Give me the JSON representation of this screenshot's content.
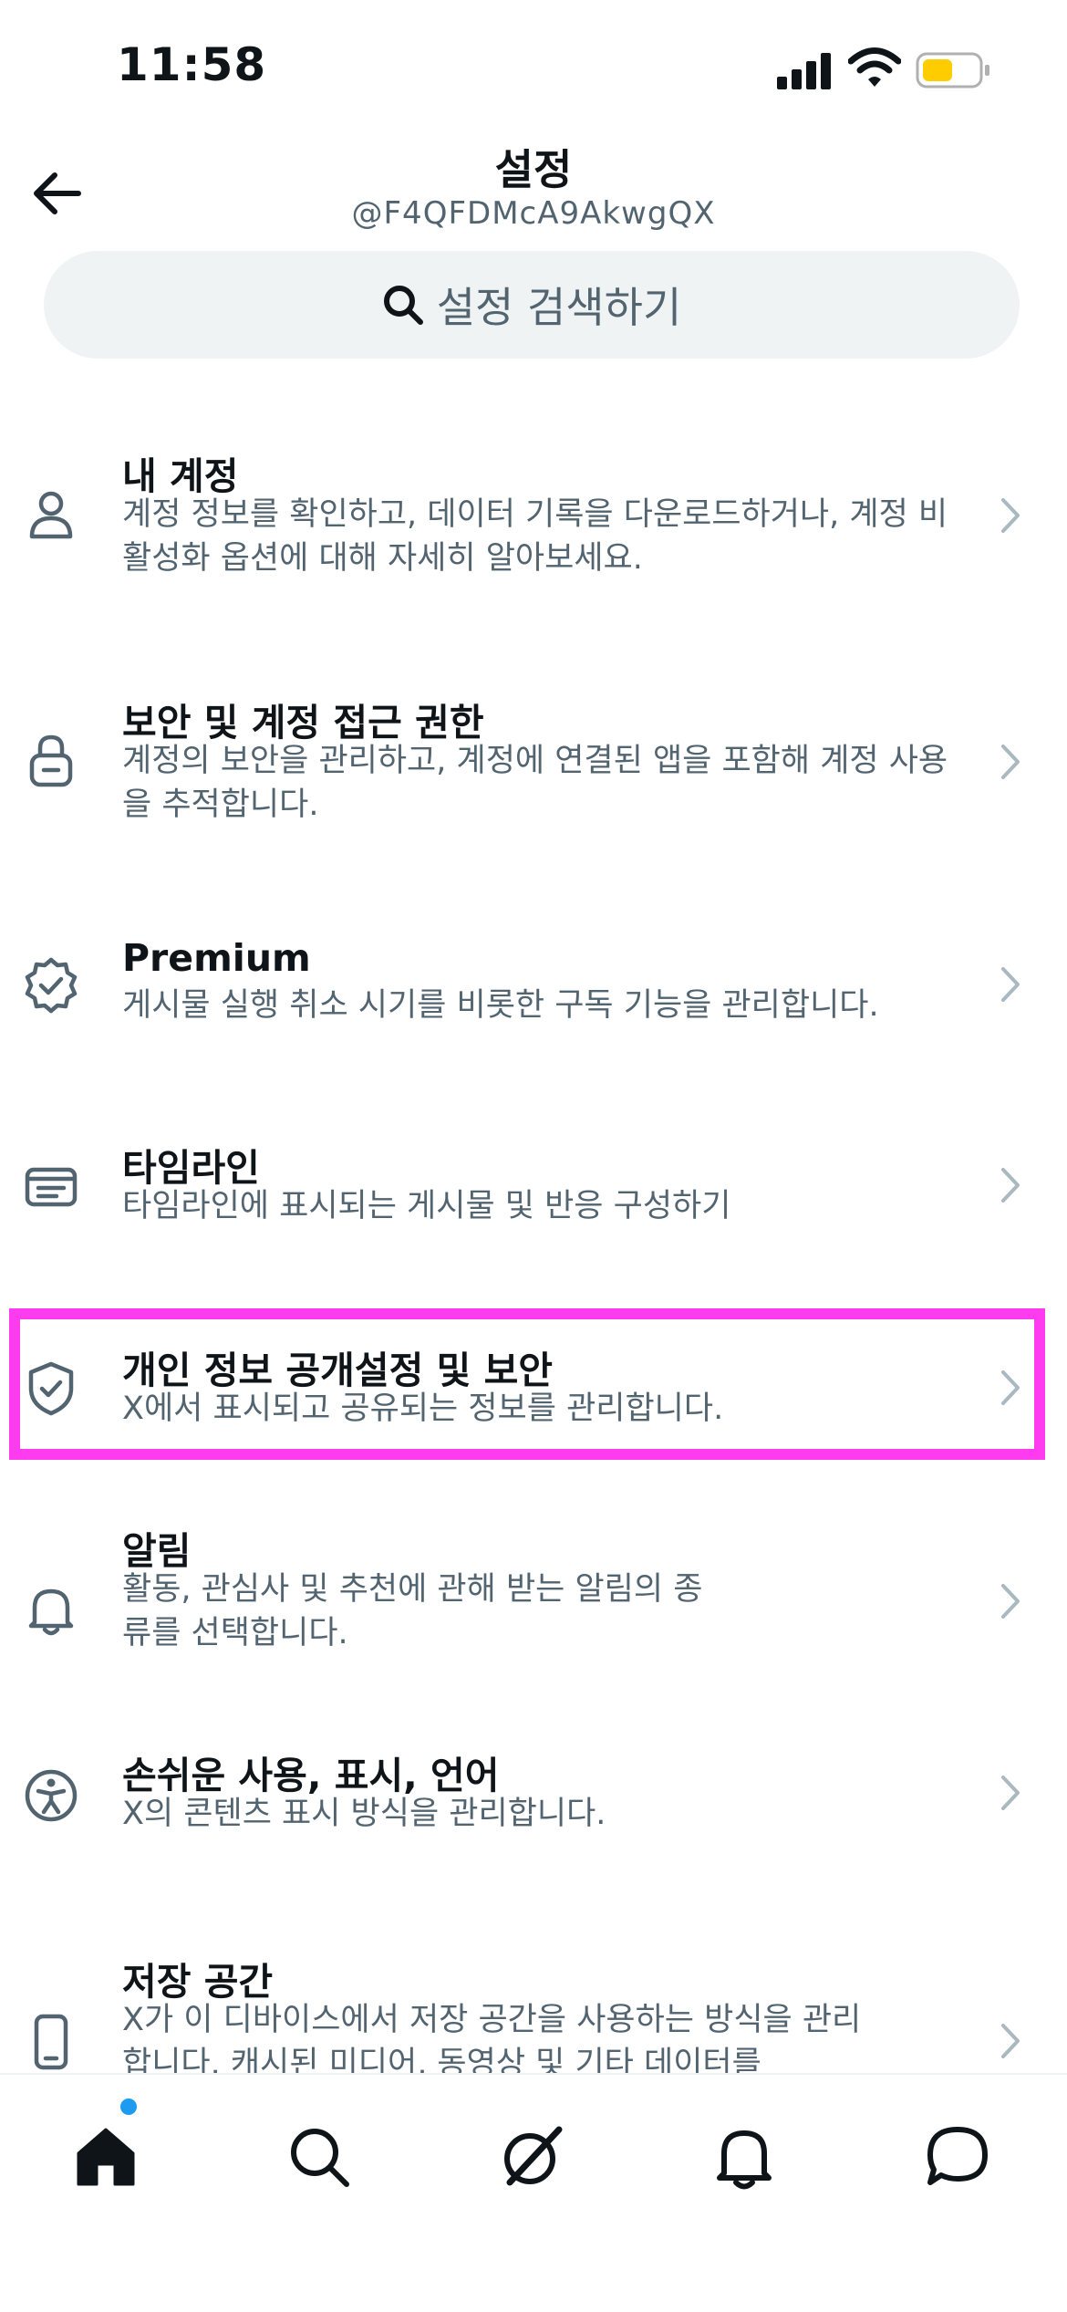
{
  "status_bar": {
    "time": "11:58"
  },
  "header": {
    "title": "설정",
    "handle": "@F4QFDMcA9AkwgQX"
  },
  "search": {
    "placeholder": "설정 검색하기"
  },
  "items": [
    {
      "title": "내 계정",
      "desc": "계정 정보를 확인하고, 데이터 기록을 다운로드하거나, 계정 비활성화 옵션에 대해 자세히 알아보세요.",
      "icon": "person-icon"
    },
    {
      "title": "보안 및 계정 접근 권한",
      "desc": "계정의 보안을 관리하고, 계정에 연결된 앱을 포함해 계정 사용을 추적합니다.",
      "icon": "lock-icon"
    },
    {
      "title": "Premium",
      "desc": "게시물 실행 취소 시기를 비롯한 구독 기능을 관리합니다.",
      "icon": "verified-badge-icon"
    },
    {
      "title": "타임라인",
      "desc": "타임라인에 표시되는 게시물 및 반응 구성하기",
      "icon": "timeline-card-icon"
    },
    {
      "title": "개인 정보 공개설정 및 보안",
      "desc": "X에서 표시되고 공유되는 정보를 관리합니다.",
      "icon": "shield-check-icon"
    },
    {
      "title": "알림",
      "desc": "활동, 관심사 및 추천에 관해 받는 알림의 종류를 선택합니다.",
      "icon": "bell-icon"
    },
    {
      "title": "손쉬운 사용, 표시, 언어",
      "desc": "X의 콘텐츠 표시 방식을 관리합니다.",
      "icon": "accessibility-icon"
    },
    {
      "title": "저장 공간",
      "desc": "X가 이 디바이스에서 저장 공간을 사용하는 방식을 관리합니다. 캐시된 미디어, 동영상 및 기타 데이터를",
      "icon": "phone-icon"
    }
  ],
  "tab_bar": {
    "tabs": [
      "home-icon",
      "search-icon",
      "grok-icon",
      "bell-icon",
      "chat-icon"
    ],
    "active": "home-icon"
  },
  "colors": {
    "text_primary": "#0f1419",
    "text_secondary": "#536471",
    "search_bg": "#eff3f4",
    "highlight": "#ff3bf0",
    "notification_dot": "#1d9bf0",
    "battery": "#ffcc00"
  }
}
